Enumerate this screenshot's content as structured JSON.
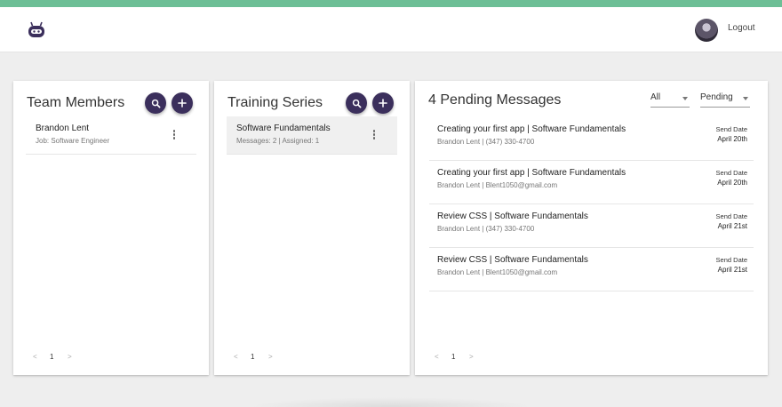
{
  "colors": {
    "accent": "#3b2f5c",
    "top_stripe": "#6dbf96",
    "background": "#eeeeee"
  },
  "header": {
    "logo_icon": "robot-logo-icon",
    "logout_label": "Logout"
  },
  "team_members": {
    "title": "Team Members",
    "search_icon": "search-icon",
    "add_icon": "plus-icon",
    "items": [
      {
        "name": "Brandon Lent",
        "detail": "Job: Software Engineer"
      }
    ],
    "pager": {
      "prev": "<",
      "page": "1",
      "next": ">"
    }
  },
  "training_series": {
    "title": "Training Series",
    "search_icon": "search-icon",
    "add_icon": "plus-icon",
    "items": [
      {
        "name": "Software Fundamentals",
        "detail": "Messages: 2 | Assigned: 1"
      }
    ],
    "pager": {
      "prev": "<",
      "page": "1",
      "next": ">"
    }
  },
  "pending_messages": {
    "title": "4 Pending Messages",
    "filter_all": "All",
    "filter_status": "Pending",
    "messages": [
      {
        "title": "Creating your first app | Software Fundamentals",
        "recipient": "Brandon Lent | (347) 330-4700",
        "send_label": "Send Date",
        "date": "April 20th"
      },
      {
        "title": "Creating your first app | Software Fundamentals",
        "recipient": "Brandon Lent | Blent1050@gmail.com",
        "send_label": "Send Date",
        "date": "April 20th"
      },
      {
        "title": "Review CSS | Software Fundamentals",
        "recipient": "Brandon Lent | (347) 330-4700",
        "send_label": "Send Date",
        "date": "April 21st"
      },
      {
        "title": "Review CSS | Software Fundamentals",
        "recipient": "Brandon Lent | Blent1050@gmail.com",
        "send_label": "Send Date",
        "date": "April 21st"
      }
    ],
    "pager": {
      "prev": "<",
      "page": "1",
      "next": ">"
    }
  }
}
